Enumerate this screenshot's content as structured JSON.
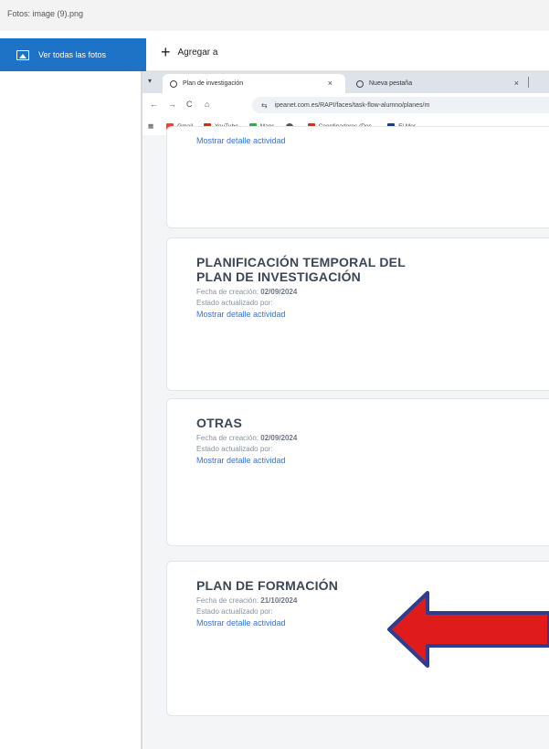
{
  "app": {
    "title": "Fotos: image (9).png",
    "all_photos_label": "Ver todas las fotos",
    "add_label": "Agregar a"
  },
  "browser": {
    "tabs": [
      {
        "title": "Plan de investigación",
        "close": "×"
      },
      {
        "title": "Nueva pestaña",
        "close": "×"
      }
    ],
    "tab_list_glyph": "▾",
    "nav": {
      "back": "←",
      "forward": "→",
      "reload": "C",
      "home": "⌂"
    },
    "url": "ipeanet.com.es/RAPI/faces/task-flow-alumno/planes/m",
    "bookmarks": [
      {
        "label": "Gmail",
        "color": "#ea4335"
      },
      {
        "label": "YouTube",
        "color": "#e62117"
      },
      {
        "label": "Maps",
        "color": "#34a853"
      },
      {
        "label": "",
        "color": "#555555"
      },
      {
        "label": "Coordinadores (Doc...",
        "color": "#d93025"
      },
      {
        "label": "El Mer",
        "color": "#1a3e8c"
      }
    ]
  },
  "cards": [
    {
      "title_lines": [],
      "date_label": "",
      "date_value": "",
      "state_label": "",
      "link": "Mostrar detalle actividad"
    },
    {
      "title_lines": [
        "PLANIFICACIÓN TEMPORAL DEL",
        "PLAN DE INVESTIGACIÓN"
      ],
      "date_label": "Fecha de creación:",
      "date_value": "02/09/2024",
      "state_label": "Estado actualizado por:",
      "link": "Mostrar detalle actividad"
    },
    {
      "title_lines": [
        "OTRAS"
      ],
      "date_label": "Fecha de creación:",
      "date_value": "02/09/2024",
      "state_label": "Estado actualizado por:",
      "link": "Mostrar detalle actividad"
    },
    {
      "title_lines": [
        "PLAN DE FORMACIÓN"
      ],
      "date_label": "Fecha de creación:",
      "date_value": "21/10/2024",
      "state_label": "Estado actualizado por:",
      "link": "Mostrar detalle actividad"
    }
  ],
  "annotation": {
    "arrow_color": "#e01b1b",
    "arrow_outline": "#2f3c8f",
    "direction": "left",
    "points_to": "cards.3.link"
  }
}
